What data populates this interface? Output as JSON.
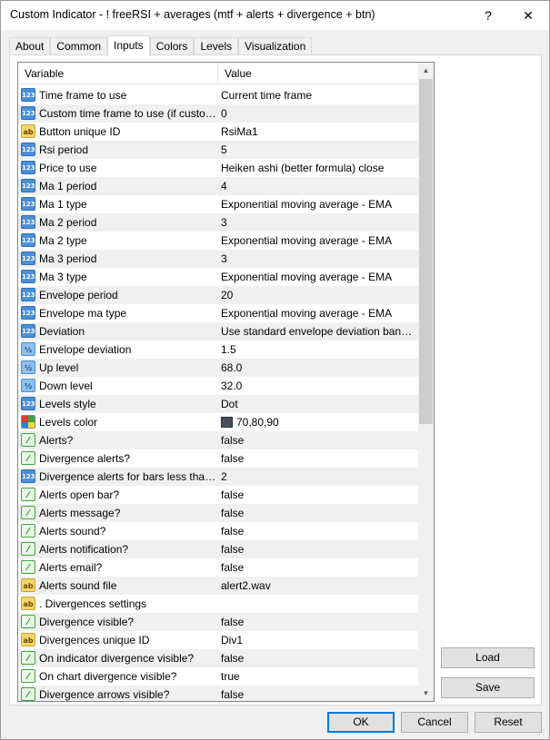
{
  "window": {
    "title": "Custom Indicator - ! freeRSI + averages (mtf + alerts + divergence + btn)",
    "help_label": "?",
    "close_label": "✕"
  },
  "tabs": [
    {
      "label": "About"
    },
    {
      "label": "Common"
    },
    {
      "label": "Inputs",
      "active": true
    },
    {
      "label": "Colors"
    },
    {
      "label": "Levels"
    },
    {
      "label": "Visualization"
    }
  ],
  "grid": {
    "header": {
      "variable": "Variable",
      "value": "Value"
    },
    "rows": [
      {
        "icon": "int-icon",
        "icon_text": "123",
        "variable": "Time frame to use",
        "value": "Current time frame"
      },
      {
        "icon": "int-icon",
        "icon_text": "123",
        "variable": "Custom time frame to use (if custom tim...",
        "value": "0"
      },
      {
        "icon": "string-icon",
        "icon_text": "ab",
        "variable": "Button unique ID",
        "value": "RsiMa1"
      },
      {
        "icon": "int-icon",
        "icon_text": "123",
        "variable": "Rsi period",
        "value": "5"
      },
      {
        "icon": "int-icon",
        "icon_text": "123",
        "variable": "Price to use",
        "value": "Heiken ashi (better formula) close"
      },
      {
        "icon": "int-icon",
        "icon_text": "123",
        "variable": "Ma 1 period",
        "value": "4"
      },
      {
        "icon": "int-icon",
        "icon_text": "123",
        "variable": "Ma 1 type",
        "value": "Exponential moving average - EMA"
      },
      {
        "icon": "int-icon",
        "icon_text": "123",
        "variable": "Ma 2 period",
        "value": "3"
      },
      {
        "icon": "int-icon",
        "icon_text": "123",
        "variable": "Ma 2 type",
        "value": "Exponential moving average - EMA"
      },
      {
        "icon": "int-icon",
        "icon_text": "123",
        "variable": "Ma 3 period",
        "value": "3"
      },
      {
        "icon": "int-icon",
        "icon_text": "123",
        "variable": "Ma 3 type",
        "value": "Exponential moving average - EMA"
      },
      {
        "icon": "int-icon",
        "icon_text": "123",
        "variable": "Envelope period",
        "value": "20"
      },
      {
        "icon": "int-icon",
        "icon_text": "123",
        "variable": "Envelope ma type",
        "value": "Exponential moving average - EMA"
      },
      {
        "icon": "int-icon",
        "icon_text": "123",
        "variable": "Deviation",
        "value": "Use standard envelope deviation bands di..."
      },
      {
        "icon": "double-icon",
        "icon_text": "½",
        "variable": "Envelope deviation",
        "value": "1.5"
      },
      {
        "icon": "double-icon",
        "icon_text": "½",
        "variable": "Up level",
        "value": "68.0"
      },
      {
        "icon": "double-icon",
        "icon_text": "½",
        "variable": "Down level",
        "value": "32.0"
      },
      {
        "icon": "int-icon",
        "icon_text": "123",
        "variable": "Levels style",
        "value": "Dot"
      },
      {
        "icon": "color-icon",
        "icon_text": "",
        "variable": "Levels color",
        "value": "70,80,90",
        "swatch": "#464f5a"
      },
      {
        "icon": "bool-icon",
        "icon_text": "⁄",
        "variable": "Alerts?",
        "value": "false"
      },
      {
        "icon": "bool-icon",
        "icon_text": "⁄",
        "variable": "Divergence alerts?",
        "value": "false"
      },
      {
        "icon": "int-icon",
        "icon_text": "123",
        "variable": "Divergence alerts for bars less than :",
        "value": "2"
      },
      {
        "icon": "bool-icon",
        "icon_text": "⁄",
        "variable": "Alerts open bar?",
        "value": "false"
      },
      {
        "icon": "bool-icon",
        "icon_text": "⁄",
        "variable": "Alerts message?",
        "value": "false"
      },
      {
        "icon": "bool-icon",
        "icon_text": "⁄",
        "variable": "Alerts sound?",
        "value": "false"
      },
      {
        "icon": "bool-icon",
        "icon_text": "⁄",
        "variable": "Alerts notification?",
        "value": "false"
      },
      {
        "icon": "bool-icon",
        "icon_text": "⁄",
        "variable": "Alerts email?",
        "value": "false"
      },
      {
        "icon": "string-icon",
        "icon_text": "ab",
        "variable": "Alerts sound file",
        "value": "alert2.wav"
      },
      {
        "icon": "string-icon",
        "icon_text": "ab",
        "variable": ".  Divergences settings",
        "value": ""
      },
      {
        "icon": "bool-icon",
        "icon_text": "⁄",
        "variable": "Divergence visible?",
        "value": "false"
      },
      {
        "icon": "string-icon",
        "icon_text": "ab",
        "variable": "Divergences unique ID",
        "value": "Div1"
      },
      {
        "icon": "bool-icon",
        "icon_text": "⁄",
        "variable": "On indicator divergence visible?",
        "value": "false"
      },
      {
        "icon": "bool-icon",
        "icon_text": "⁄",
        "variable": "On chart divergence visible?",
        "value": "true"
      },
      {
        "icon": "bool-icon",
        "icon_text": "⁄",
        "variable": "Divergence arrows visible?",
        "value": "false"
      }
    ]
  },
  "buttons": {
    "load": "Load",
    "save": "Save",
    "ok": "OK",
    "cancel": "Cancel",
    "reset": "Reset"
  },
  "scrollbar": {
    "up": "▲",
    "down": "▼",
    "thumb_fraction": 0.57
  }
}
